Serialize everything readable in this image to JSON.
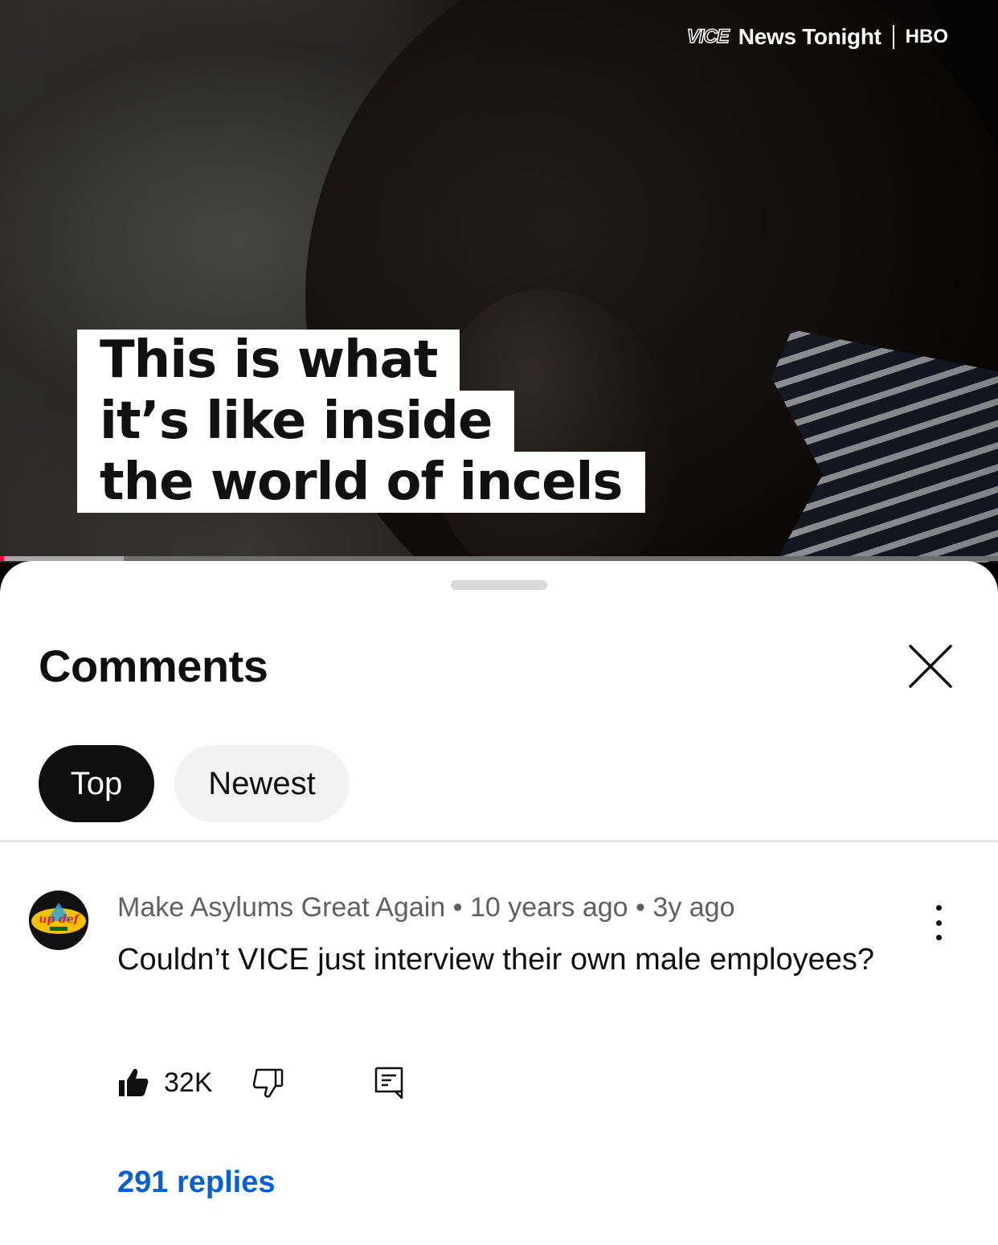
{
  "video": {
    "brand": {
      "logo": "VICE",
      "show": "News Tonight",
      "network": "HBO"
    },
    "caption_lines": [
      "This is what",
      "it’s like inside",
      "the world of incels"
    ],
    "progress": {
      "played": 0.004,
      "buffered": 0.124
    },
    "accent_color": "#ff0033"
  },
  "comments": {
    "title": "Comments",
    "close_icon": "close-icon",
    "filters": [
      {
        "label": "Top",
        "selected": true
      },
      {
        "label": "Newest",
        "selected": false
      }
    ],
    "items": [
      {
        "author": "Make Asylums Great Again",
        "account_age": "10 years ago",
        "posted": "3y ago",
        "meta_separator": "•",
        "avatar_text": "up def",
        "text": "Couldn’t VICE just interview their own male employees?",
        "likes": "32K",
        "replies": "291 replies",
        "link_color": "#065fd4"
      }
    ]
  }
}
